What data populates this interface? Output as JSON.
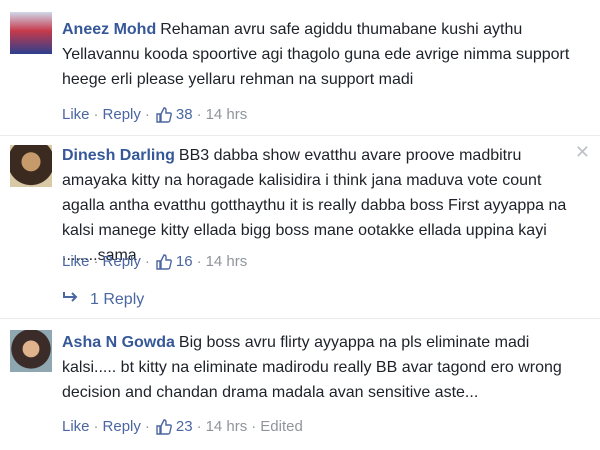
{
  "colors": {
    "link": "#4b67a1",
    "author": "#365899",
    "muted": "#90949c"
  },
  "comments": [
    {
      "author": "Aneez Mohd",
      "text": "Rehaman avru safe agiddu thumabane kushi aythu Yellavannu kooda spoortive agi thagolo guna ede avrige nimma support heege erli please yellaru rehman na support madi",
      "actions": {
        "like": "Like",
        "reply": "Reply",
        "likes": "38",
        "time": "14 hrs"
      }
    },
    {
      "author": "Dinesh Darling",
      "text": "BB3 dabba show evatthu avare proove madbitru amayaka kitty na horagade kalisidira i think jana maduva vote count agalla antha evatthu gotthaythu it is really dabba boss First ayyappa na kalsi manege kitty ellada bigg boss mane ootakke ellada uppina kayi ........sama",
      "actions": {
        "like": "Like",
        "reply": "Reply",
        "likes": "16",
        "time": "14 hrs"
      },
      "replies": "1 Reply"
    },
    {
      "author": "Asha N Gowda",
      "text": "Big boss avru flirty ayyappa na pls eliminate madi kalsi..... bt kitty na eliminate madirodu really BB avar tagond ero wrong decision and chandan drama madala avan sensitive aste...",
      "actions": {
        "like": "Like",
        "reply": "Reply",
        "likes": "23",
        "time": "14 hrs",
        "edited": "Edited"
      }
    }
  ]
}
